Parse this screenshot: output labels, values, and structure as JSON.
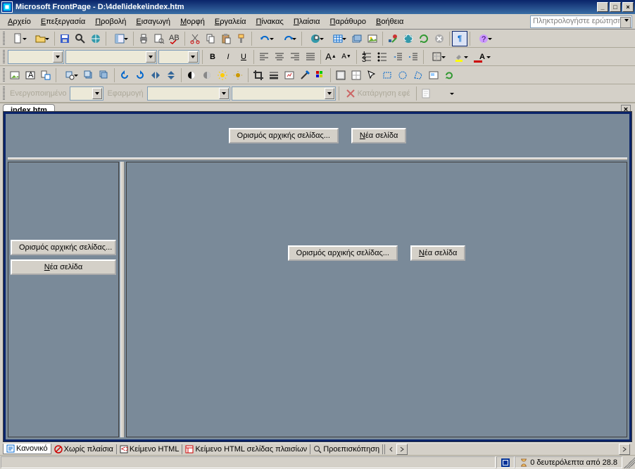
{
  "title": "Microsoft FrontPage - D:\\4del\\ideke\\index.htm",
  "ask_placeholder": "Πληκτρολογήστε ερώτηση",
  "menus": [
    "Αρχείο",
    "Επεξεργασία",
    "Προβολή",
    "Εισαγωγή",
    "Μορφή",
    "Εργαλεία",
    "Πίνακας",
    "Πλαίσια",
    "Παράθυρο",
    "Βοήθεια"
  ],
  "doc_tab": "index.htm",
  "row4": {
    "enabled_label": "Ενεργοποιημένο",
    "apply_label": "Εφαρμογή",
    "remove_effect": "Κατάργηση εφέ"
  },
  "frame_buttons": {
    "set_initial": "Ορισμός αρχικής σελίδας...",
    "new_page": "Νέα σελίδα",
    "new_page_u": "Ν"
  },
  "view_tabs": [
    "Κανονικό",
    "Χωρίς πλαίσια",
    "Κείμενο HTML",
    "Κείμενο HTML σελίδας πλαισίων",
    "Προεπισκόπηση"
  ],
  "status": {
    "timing": "0 δευτερόλεπτα από 28.8"
  }
}
